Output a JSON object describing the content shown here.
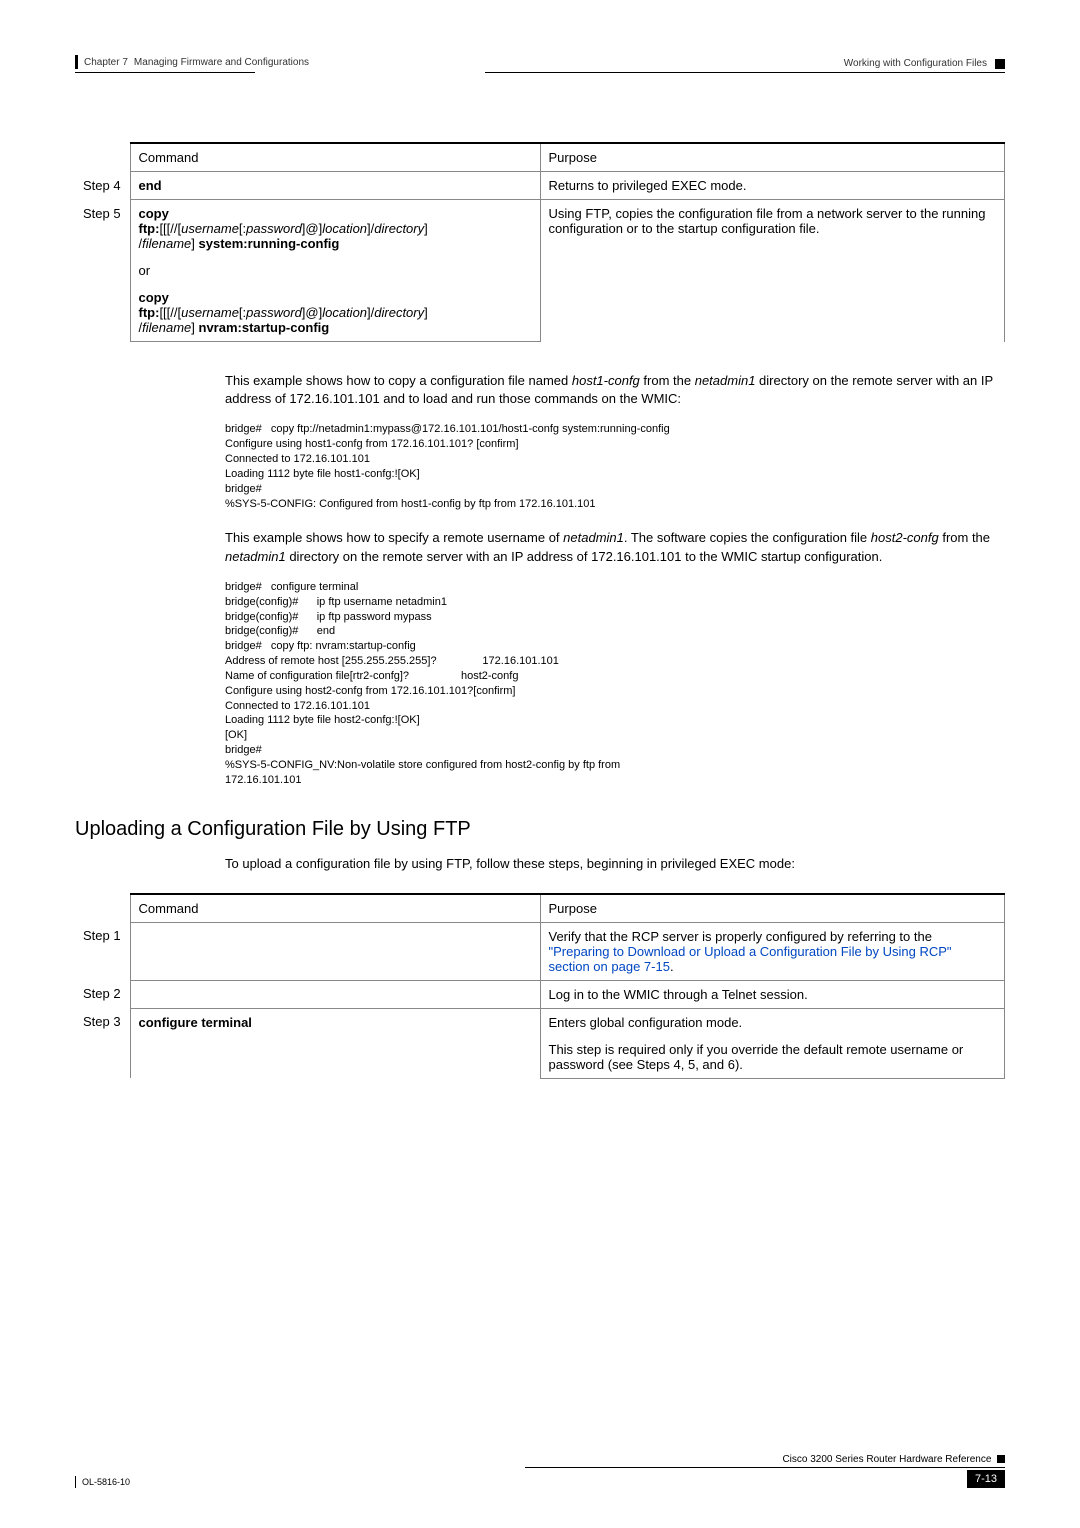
{
  "header": {
    "chapter": "Chapter 7",
    "chapter_title": "Managing Firmware and Configurations",
    "section": "Working with Configuration Files"
  },
  "table1": {
    "headers": {
      "command": "Command",
      "purpose": "Purpose"
    },
    "step4": {
      "label": "Step 4",
      "cmd": "end",
      "purpose": "Returns to privileged EXEC mode."
    },
    "step5": {
      "label": "Step 5",
      "cmd_bold1": "copy",
      "cmd_line1a": "ftp:",
      "cmd_line1b": "[[[//[",
      "cmd_line1c": "username",
      "cmd_line1d": "[:",
      "cmd_line1e": "password",
      "cmd_line1f": "]@]",
      "cmd_line1g": "location",
      "cmd_line1h": "]/",
      "cmd_line1i": "directory",
      "cmd_line1j": "]",
      "cmd_line2a": "/",
      "cmd_line2b": "filename",
      "cmd_line2c": "]",
      "cmd_line2d": " system:running-config",
      "or": "or",
      "cmd_bold2": "copy",
      "cmd_alt2d": " nvram:startup-config",
      "purpose": "Using FTP, copies the configuration file from a network server to the running configuration or to the startup configuration file."
    }
  },
  "para1_a": "This example shows how to copy a configuration file named ",
  "para1_b": "host1-confg",
  "para1_c": " from the ",
  "para1_d": "netadmin1",
  "para1_e": " directory on the remote server with an IP address of 172.16.101.101 and to load and run those commands on the WMIC:",
  "code1": "bridge#   copy ftp://netadmin1:mypass@172.16.101.101/host1-confg system:running-config\nConfigure using host1-confg from 172.16.101.101? [confirm]\nConnected to 172.16.101.101\nLoading 1112 byte file host1-confg:![OK]\nbridge#\n%SYS-5-CONFIG: Configured from host1-config by ftp from 172.16.101.101",
  "para2_a": "This example shows how to specify a remote username of ",
  "para2_b": "netadmin1",
  "para2_c": ". The software copies the configuration file ",
  "para2_d": "host2-confg",
  "para2_e": " from the ",
  "para2_f": "netadmin1",
  "para2_g": " directory on the remote server with an IP address of 172.16.101.101 to the WMIC startup configuration.",
  "code2": "bridge#   configure terminal\nbridge(config)#      ip ftp username netadmin1\nbridge(config)#      ip ftp password mypass\nbridge(config)#      end\nbridge#   copy ftp: nvram:startup-config\nAddress of remote host [255.255.255.255]?               172.16.101.101\nName of configuration file[rtr2-confg]?                 host2-confg\nConfigure using host2-confg from 172.16.101.101?[confirm]\nConnected to 172.16.101.101\nLoading 1112 byte file host2-confg:![OK]\n[OK]\nbridge#\n%SYS-5-CONFIG_NV:Non-volatile store configured from host2-config by ftp from\n172.16.101.101",
  "section_title": "Uploading a Configuration File by Using FTP",
  "para3": "To upload a configuration file by using FTP, follow these steps, beginning in privileged EXEC mode:",
  "table2": {
    "headers": {
      "command": "Command",
      "purpose": "Purpose"
    },
    "step1": {
      "label": "Step 1",
      "purpose_a": "Verify that the RCP server is properly configured by referring to the ",
      "purpose_link": "\"Preparing to Download or Upload a Configuration File by Using RCP\" section on page 7-15",
      "purpose_b": "."
    },
    "step2": {
      "label": "Step 2",
      "purpose": "Log in to the WMIC through a Telnet session."
    },
    "step3": {
      "label": "Step 3",
      "cmd": "configure terminal",
      "purpose1": "Enters global configuration mode.",
      "purpose2": "This step is required only if you override the default remote username or password (see Steps 4, 5, and 6)."
    }
  },
  "footer": {
    "doc_title": "Cisco 3200 Series Router Hardware Reference",
    "doc_id": "OL-5816-10",
    "page": "7-13"
  }
}
